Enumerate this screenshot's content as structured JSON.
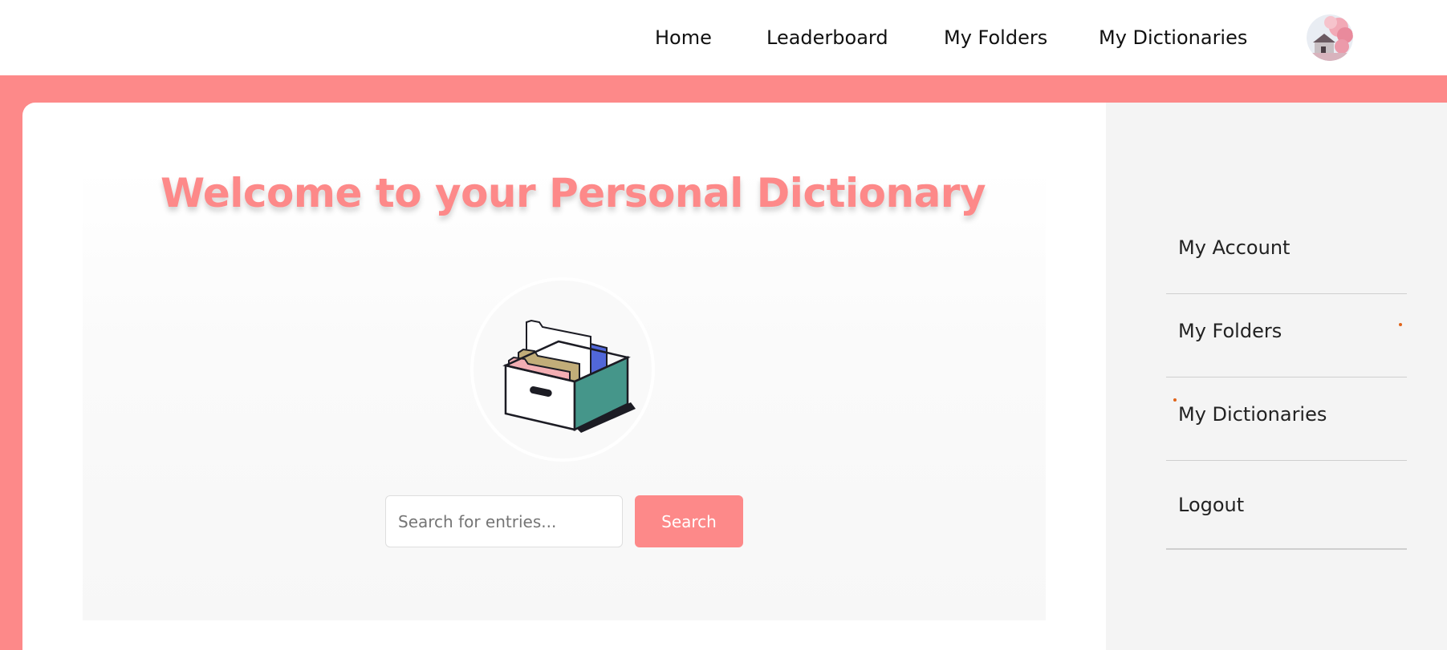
{
  "nav": {
    "home": "Home",
    "leaderboard": "Leaderboard",
    "my_folders": "My Folders",
    "my_dictionaries": "My Dictionaries"
  },
  "hero": {
    "title": "Welcome to your Personal Dictionary"
  },
  "search": {
    "placeholder": "Search for entries...",
    "value": "",
    "button_label": "Search"
  },
  "sidebar": {
    "items": [
      {
        "label": "My Account"
      },
      {
        "label": "My Folders"
      },
      {
        "label": "My Dictionaries"
      },
      {
        "label": "Logout"
      }
    ]
  },
  "colors": {
    "accent": "#fd8989",
    "nav_text": "#111111",
    "sidebar_bg": "#f4f4f4",
    "box_teal": "#45968a"
  },
  "icons": {
    "avatar": "avatar-image",
    "illustration": "file-box-icon"
  }
}
